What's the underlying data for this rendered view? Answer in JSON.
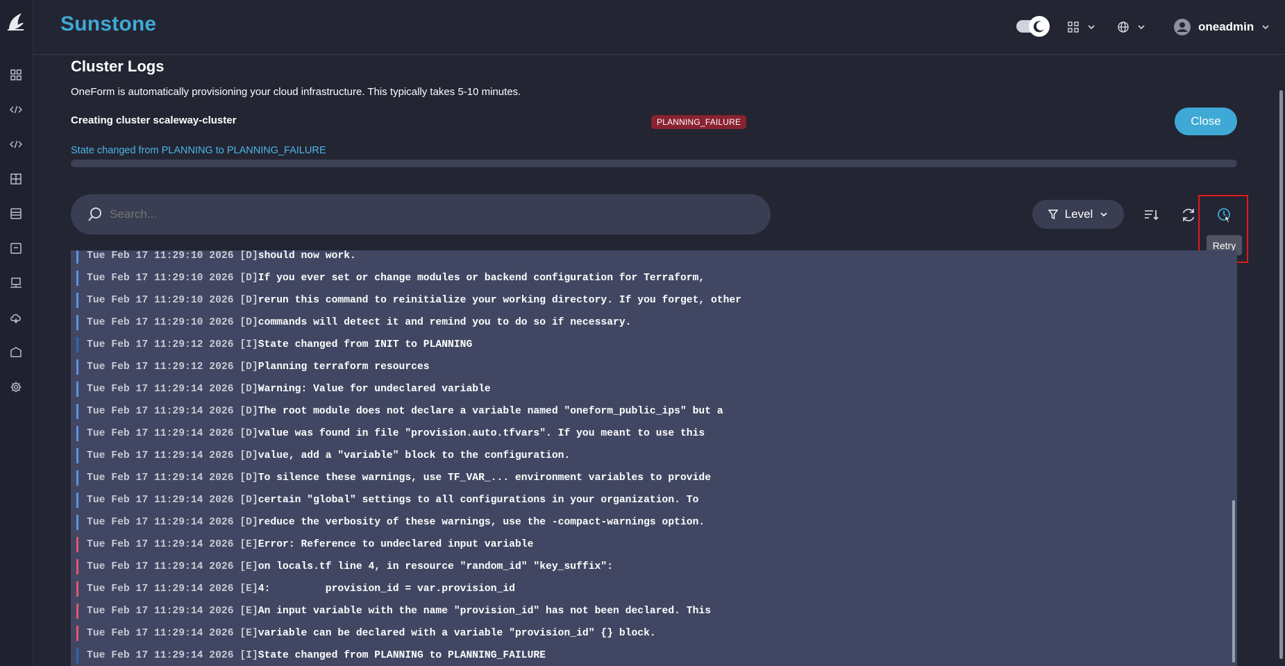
{
  "app": {
    "brand": "Sunstone",
    "user": "oneadmin"
  },
  "icons": {
    "logo": "opennebula-bird-icon",
    "sidebar": [
      "dashboard-icon",
      "code-icon",
      "code-icon",
      "grid-icon",
      "storage-icon",
      "archive-icon",
      "monitor-icon",
      "cloud-icon",
      "box-icon",
      "gear-icon"
    ],
    "top": [
      "theme-toggle",
      "apps-grid-icon",
      "globe-icon",
      "user-avatar-icon"
    ]
  },
  "colors": {
    "accent": "#3fa9d6",
    "failure": "#8a2230",
    "debug_bar": "#5b94e6",
    "info_bar": "#2a6ab0",
    "error_bar": "#e0586e"
  },
  "page": {
    "title": "Cluster Logs",
    "subtitle": "OneForm is automatically provisioning your cloud infrastructure. This typically takes 5-10 minutes.",
    "creating": "Creating cluster scaleway-cluster",
    "status": "PLANNING_FAILURE",
    "close_label": "Close",
    "state_message": "State changed from PLANNING to PLANNING_FAILURE",
    "progress": 0
  },
  "toolbar": {
    "search_placeholder": "Search...",
    "level_label": "Level",
    "retry_tooltip": "Retry"
  },
  "logs": [
    {
      "time": "Tue Feb 17 11:29:10 2026",
      "level": "D",
      "text": "should now work."
    },
    {
      "time": "Tue Feb 17 11:29:10 2026",
      "level": "D",
      "text": "If you ever set or change modules or backend configuration for Terraform,"
    },
    {
      "time": "Tue Feb 17 11:29:10 2026",
      "level": "D",
      "text": "rerun this command to reinitialize your working directory. If you forget, other"
    },
    {
      "time": "Tue Feb 17 11:29:10 2026",
      "level": "D",
      "text": "commands will detect it and remind you to do so if necessary."
    },
    {
      "time": "Tue Feb 17 11:29:12 2026",
      "level": "I",
      "text": "State changed from INIT to PLANNING"
    },
    {
      "time": "Tue Feb 17 11:29:12 2026",
      "level": "D",
      "text": "Planning terraform resources"
    },
    {
      "time": "Tue Feb 17 11:29:14 2026",
      "level": "D",
      "text": "Warning: Value for undeclared variable"
    },
    {
      "time": "Tue Feb 17 11:29:14 2026",
      "level": "D",
      "text": "The root module does not declare a variable named \"oneform_public_ips\" but a"
    },
    {
      "time": "Tue Feb 17 11:29:14 2026",
      "level": "D",
      "text": "value was found in file \"provision.auto.tfvars\". If you meant to use this"
    },
    {
      "time": "Tue Feb 17 11:29:14 2026",
      "level": "D",
      "text": "value, add a \"variable\" block to the configuration."
    },
    {
      "time": "Tue Feb 17 11:29:14 2026",
      "level": "D",
      "text": "To silence these warnings, use TF_VAR_... environment variables to provide"
    },
    {
      "time": "Tue Feb 17 11:29:14 2026",
      "level": "D",
      "text": "certain \"global\" settings to all configurations in your organization. To"
    },
    {
      "time": "Tue Feb 17 11:29:14 2026",
      "level": "D",
      "text": "reduce the verbosity of these warnings, use the -compact-warnings option."
    },
    {
      "time": "Tue Feb 17 11:29:14 2026",
      "level": "E",
      "text": "Error: Reference to undeclared input variable"
    },
    {
      "time": "Tue Feb 17 11:29:14 2026",
      "level": "E",
      "text": "on locals.tf line 4, in resource \"random_id\" \"key_suffix\":"
    },
    {
      "time": "Tue Feb 17 11:29:14 2026",
      "level": "E",
      "text": "4:         provision_id = var.provision_id"
    },
    {
      "time": "Tue Feb 17 11:29:14 2026",
      "level": "E",
      "text": "An input variable with the name \"provision_id\" has not been declared. This"
    },
    {
      "time": "Tue Feb 17 11:29:14 2026",
      "level": "E",
      "text": "variable can be declared with a variable \"provision_id\" {} block."
    },
    {
      "time": "Tue Feb 17 11:29:14 2026",
      "level": "I",
      "text": "State changed from PLANNING to PLANNING_FAILURE"
    }
  ]
}
